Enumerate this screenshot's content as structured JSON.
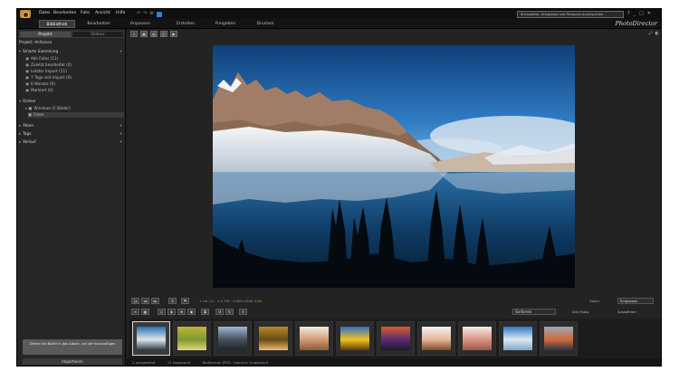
{
  "menu": {
    "items": [
      "Datei",
      "Bearbeiten",
      "Foto",
      "Ansicht",
      "Hilfe"
    ],
    "search_text": "Stichwörter, Ereignisse und Personen durchsuchen",
    "window_controls": [
      "?",
      "_",
      "□",
      "✕"
    ]
  },
  "modules": {
    "tabs": [
      "Bibliothek",
      "Bearbeiten",
      "Anpassen",
      "Erstellen",
      "Freigeben",
      "Drucken"
    ],
    "active": "Bibliothek",
    "brand": "PhotoDirector"
  },
  "left_panel": {
    "tabs": [
      "Projekt",
      "Ordner"
    ],
    "project_label": "Projekt: Anfassen",
    "sections": [
      {
        "label": "Smarte Sammlung",
        "expanded": true
      },
      {
        "label": "Ordner",
        "expanded": true
      },
      {
        "label": "Alben",
        "expanded": false
      },
      {
        "label": "Tags",
        "expanded": false
      },
      {
        "label": "Verlauf",
        "expanded": false
      }
    ],
    "smart_items": [
      "Alle Fotos (11)",
      "Zuletzt bearbeitet (0)",
      "Letzter Import (11)",
      "7 Tage seit Import (0)",
      "6 Monate (0)",
      "Markiert (0)"
    ],
    "folder_items": [
      "Windows (F:\\Bilder)",
      "Fotos"
    ],
    "bottom_note": "Ziehen Sie Bilder in das Album, um sie hinzuzufügen",
    "bottom_button": "Importieren"
  },
  "main": {
    "tool_icons": [
      "import-icon",
      "grid-icon",
      "filmstrip-icon",
      "compare-icon",
      "slideshow-icon"
    ],
    "view_controls": [
      "⤢",
      "◐"
    ],
    "nav_info": "1 von 11 · 4.0 MB · 4288×2848",
    "nav_green": "1.0x",
    "zoom_label": "Zoom",
    "zoom_value": "Einpassen",
    "sort_value": "Sortieren",
    "strip_texts": [
      "Alle Fotos",
      "Auswählen"
    ]
  },
  "filmstrip": {
    "thumbs": [
      {
        "name": "mountain-lake",
        "colors": [
          "#2a6fb5",
          "#dfe5ea",
          "#2d3a44"
        ]
      },
      {
        "name": "yellow-leaves",
        "colors": [
          "#c7b23a",
          "#7b9a2f",
          "#e6d67a"
        ]
      },
      {
        "name": "city-sky",
        "colors": [
          "#9fb7d4",
          "#46505c",
          "#1e242c"
        ]
      },
      {
        "name": "golden-still-life",
        "colors": [
          "#b88a2a",
          "#6b4a14",
          "#e6bf6a"
        ]
      },
      {
        "name": "portrait-woman",
        "colors": [
          "#f1ece2",
          "#d39b73",
          "#8a5a3c"
        ]
      },
      {
        "name": "sunflower",
        "colors": [
          "#2b6fcb",
          "#f2c21c",
          "#5a3a12"
        ]
      },
      {
        "name": "sunset-field",
        "colors": [
          "#d85a2c",
          "#5a2c6e",
          "#1e1a2a"
        ]
      },
      {
        "name": "portrait-girl",
        "colors": [
          "#f2f2f2",
          "#e7b796",
          "#7a4a2e"
        ]
      },
      {
        "name": "portrait-close",
        "colors": [
          "#f4ece6",
          "#d99482",
          "#a0564a"
        ]
      },
      {
        "name": "beach-blue",
        "colors": [
          "#2e77c8",
          "#dfe9f2",
          "#7fa7c9"
        ]
      },
      {
        "name": "harbor-sunset",
        "colors": [
          "#9aa7b7",
          "#d16a3a",
          "#2a3340"
        ]
      }
    ]
  },
  "status": {
    "texts": [
      "1 ausgewählt",
      "11 insgesamt",
      "Bildformat: JPEG · Kamera: Unbekannt"
    ]
  }
}
